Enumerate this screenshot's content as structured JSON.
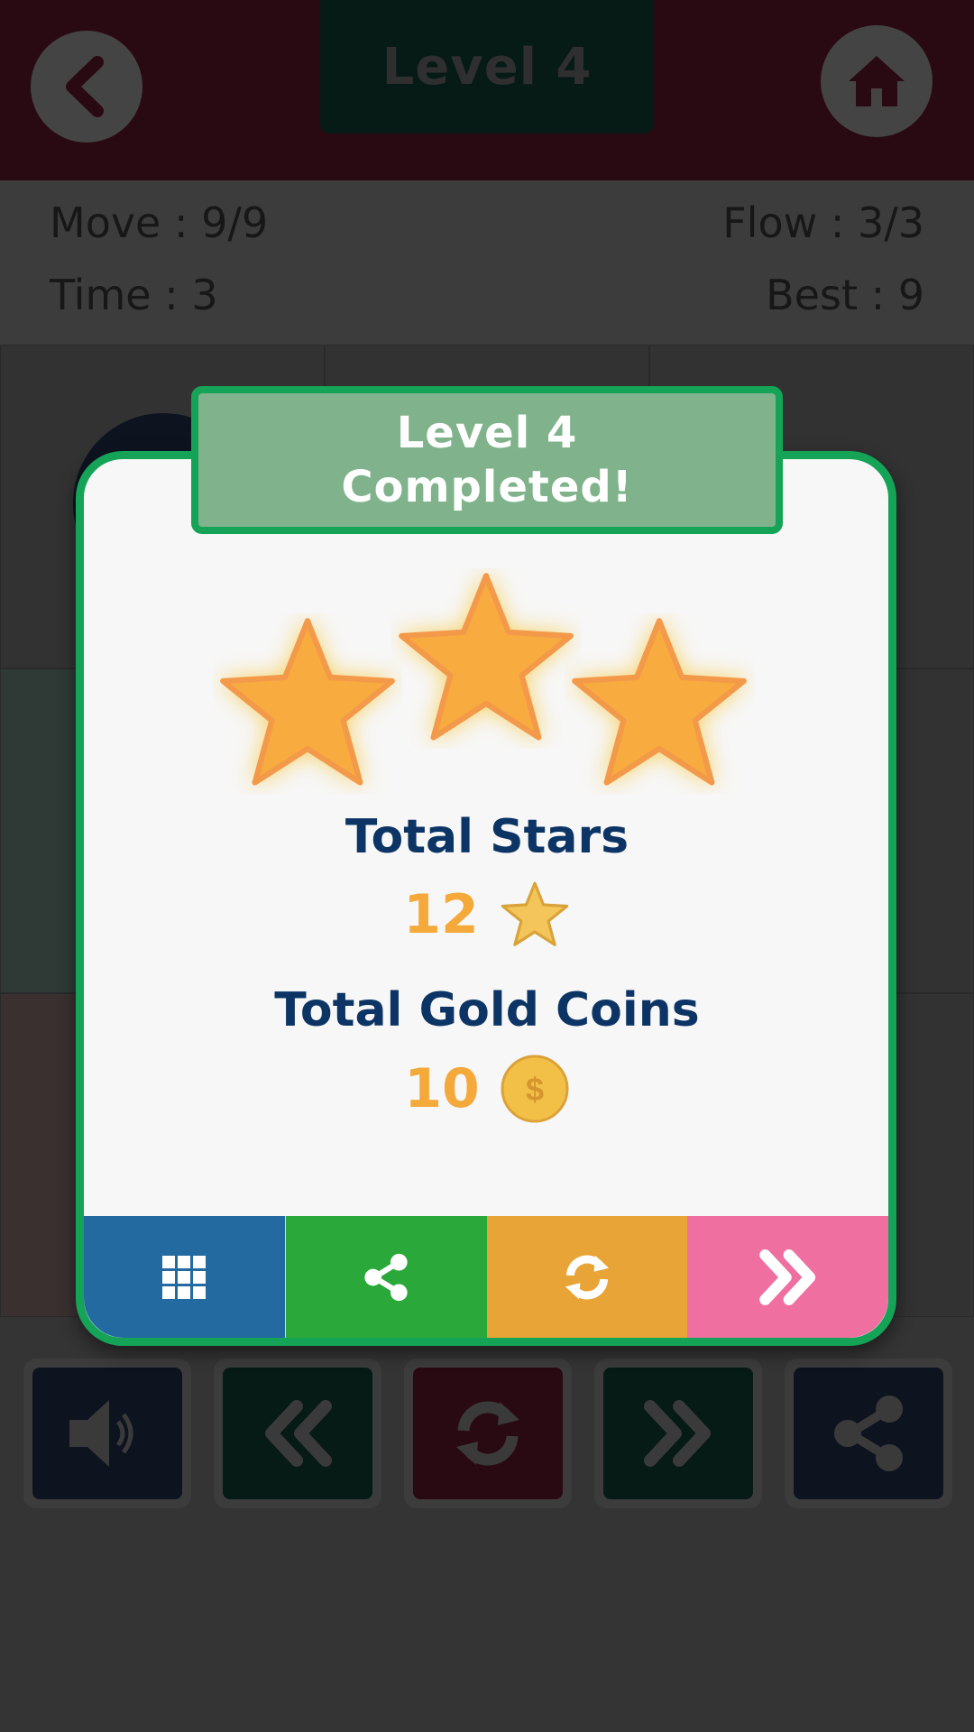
{
  "header": {
    "level_title": "Level 4",
    "back_icon": "chevron-left-icon",
    "home_icon": "home-icon"
  },
  "stats": {
    "move": "Move : 9/9",
    "time": "Time : 3",
    "flow": "Flow : 3/3",
    "best": "Best : 9"
  },
  "controls": [
    {
      "name": "sound",
      "icon": "speaker-icon"
    },
    {
      "name": "previous-level",
      "icon": "double-chevron-left-icon"
    },
    {
      "name": "restart",
      "icon": "refresh-icon"
    },
    {
      "name": "next-level",
      "icon": "double-chevron-right-icon"
    },
    {
      "name": "share",
      "icon": "share-icon"
    }
  ],
  "modal": {
    "title_line1": "Level 4",
    "title_line2": "Completed!",
    "stars_earned": 3,
    "stars_max": 3,
    "total_stars_label": "Total Stars",
    "total_stars_value": "12",
    "total_coins_label": "Total Gold Coins",
    "total_coins_value": "10",
    "coin_symbol": "$",
    "buttons": [
      {
        "name": "levels",
        "icon": "grid-icon",
        "color": "#236aa0"
      },
      {
        "name": "share",
        "icon": "share-icon",
        "color": "#2aa83a"
      },
      {
        "name": "replay",
        "icon": "refresh-icon",
        "color": "#e8a436"
      },
      {
        "name": "next",
        "icon": "double-chevron-right-icon",
        "color": "#ee6fa0"
      }
    ]
  },
  "colors": {
    "accent_green": "#15a357",
    "star_orange": "#f8ab3e",
    "label_navy": "#0c3464",
    "value_orange": "#f5a93b"
  }
}
